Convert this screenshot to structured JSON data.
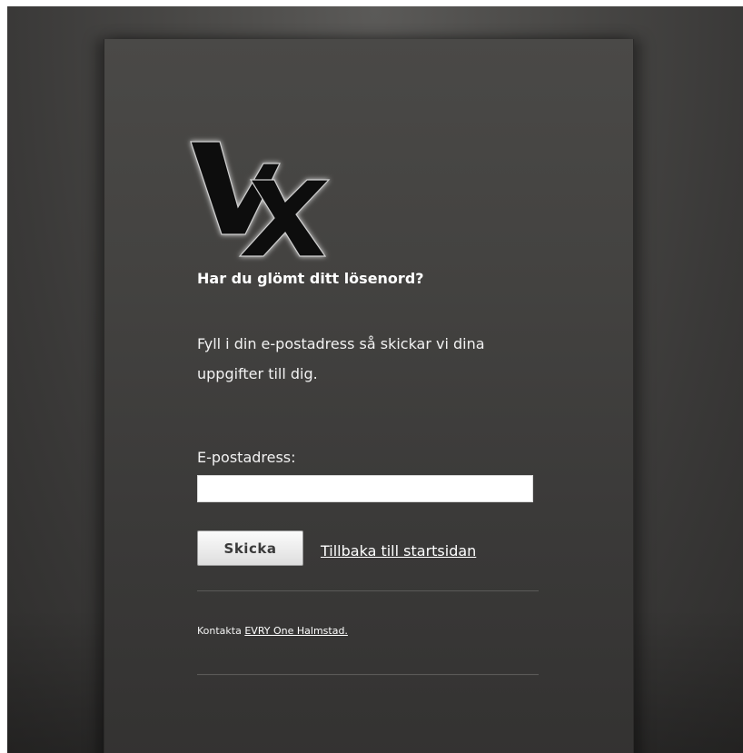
{
  "logo": {
    "text": "VX",
    "icon": "vx-logo-icon"
  },
  "reset": {
    "heading": "Har du glömt ditt lösenord?",
    "intro": "Fyll i din e-postadress så skickar vi dina uppgifter till dig.",
    "email_label": "E-postadress:",
    "email_value": "",
    "email_placeholder": "",
    "send_label": "Skicka",
    "back_link": "Tillbaka till startsidan"
  },
  "footer": {
    "contact_prefix": "Kontakta",
    "contact_link": "EVRY One Halmstad."
  },
  "colors": {
    "background": "#3e3d3c",
    "panel": "#444341",
    "text": "#ffffff",
    "button": "#ededed"
  }
}
